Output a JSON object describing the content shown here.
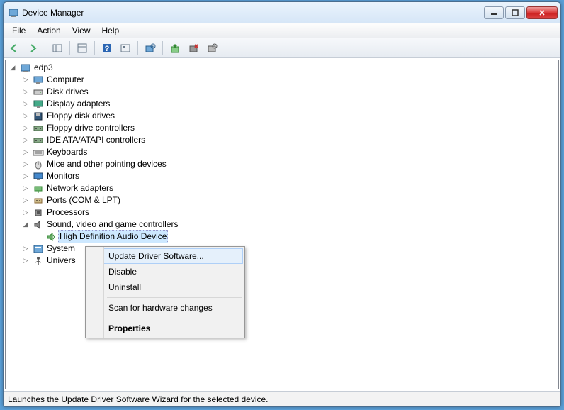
{
  "title": "Device Manager",
  "menu": [
    "File",
    "Action",
    "View",
    "Help"
  ],
  "status": "Launches the Update Driver Software Wizard for the selected device.",
  "root": "edp3",
  "tree": [
    {
      "label": "Computer",
      "icon": "computer"
    },
    {
      "label": "Disk drives",
      "icon": "disk"
    },
    {
      "label": "Display adapters",
      "icon": "display"
    },
    {
      "label": "Floppy disk drives",
      "icon": "floppy"
    },
    {
      "label": "Floppy drive controllers",
      "icon": "controller"
    },
    {
      "label": "IDE ATA/ATAPI controllers",
      "icon": "controller"
    },
    {
      "label": "Keyboards",
      "icon": "keyboard"
    },
    {
      "label": "Mice and other pointing devices",
      "icon": "mouse"
    },
    {
      "label": "Monitors",
      "icon": "monitor"
    },
    {
      "label": "Network adapters",
      "icon": "network"
    },
    {
      "label": "Ports (COM & LPT)",
      "icon": "port"
    },
    {
      "label": "Processors",
      "icon": "cpu"
    },
    {
      "label": "Sound, video and game controllers",
      "icon": "sound",
      "expanded": true,
      "children": [
        {
          "label": "High Definition Audio Device",
          "icon": "speaker",
          "selected": true
        }
      ]
    },
    {
      "label": "System",
      "icon": "system",
      "truncated": true
    },
    {
      "label": "Univers",
      "icon": "usb",
      "truncated": true
    }
  ],
  "context_menu": {
    "items": [
      {
        "label": "Update Driver Software...",
        "hover": true
      },
      {
        "label": "Disable"
      },
      {
        "label": "Uninstall"
      },
      {
        "sep": true
      },
      {
        "label": "Scan for hardware changes"
      },
      {
        "sep": true
      },
      {
        "label": "Properties",
        "bold": true
      }
    ]
  }
}
